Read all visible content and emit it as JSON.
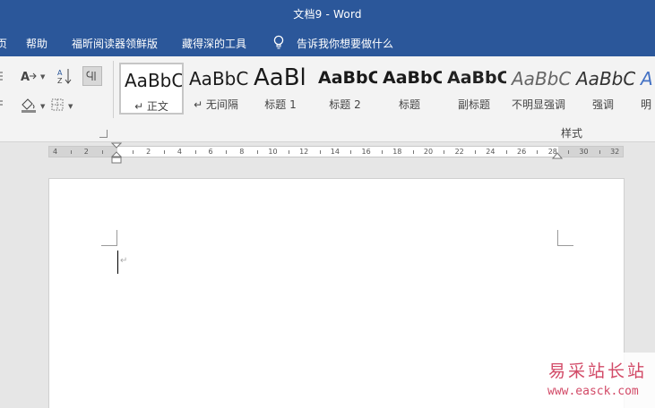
{
  "window": {
    "title": "文档9  -  Word"
  },
  "menu": {
    "tabs": [
      {
        "label": "页"
      },
      {
        "label": "帮助"
      },
      {
        "label": "福昕阅读器领鲜版"
      },
      {
        "label": "藏得深的工具"
      }
    ],
    "tell_me": "告诉我你想要做什么"
  },
  "ribbon": {
    "styles_group_label": "样式",
    "styles": [
      {
        "sample": "AaBbC",
        "label": "↵ 正文"
      },
      {
        "sample": "AaBbC",
        "label": "↵ 无间隔"
      },
      {
        "sample": "AaBl",
        "label": "标题 1"
      },
      {
        "sample": "AaBbC",
        "label": "标题 2"
      },
      {
        "sample": "AaBbC",
        "label": "标题"
      },
      {
        "sample": "AaBbC",
        "label": "副标题"
      },
      {
        "sample": "AaBbC",
        "label": "不明显强调"
      },
      {
        "sample": "AaBbC",
        "label": "强调"
      },
      {
        "sample": "A",
        "label": "明"
      }
    ]
  },
  "ruler": {
    "labels": [
      "4",
      "2",
      "2",
      "4",
      "6",
      "8",
      "10",
      "12",
      "14",
      "16",
      "18",
      "20",
      "22",
      "24",
      "26",
      "28",
      "30",
      "32"
    ]
  },
  "document": {
    "paragraph_mark": "↵"
  },
  "watermark": {
    "name": "易采站长站",
    "url": "www.easck.com"
  },
  "colors": {
    "title_bar": "#2b579a",
    "ribbon_bg": "#f3f3f3",
    "workspace": "#e6e6e6",
    "watermark": "#d24a67"
  },
  "icons": [
    "lightbulb-icon",
    "text-effects-icon",
    "sort-icon",
    "show-formatting-icon",
    "shading-icon",
    "borders-icon",
    "dialog-launcher-icon"
  ]
}
